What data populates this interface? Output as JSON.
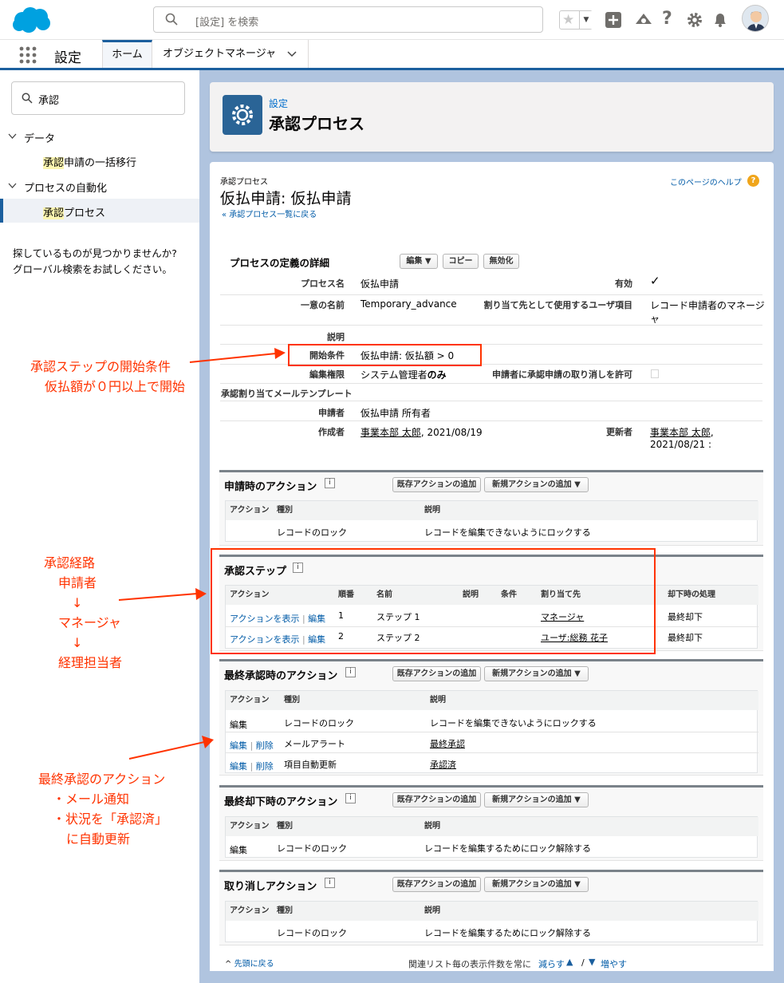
{
  "header": {
    "search_placeholder": "[設定] を検索"
  },
  "nav": {
    "app_name": "設定",
    "tab_home": "ホーム",
    "tab_object_manager": "オブジェクトマネージャ"
  },
  "sidebar": {
    "quickfind_value": "承認",
    "group_data": "データ",
    "item_bulk_prefix": "承認",
    "item_bulk_rest": "申請の一括移行",
    "group_automation": "プロセスの自動化",
    "item_process_prefix": "承認",
    "item_process_rest": "プロセス",
    "not_found_line1": "探しているものが見つかりませんか?",
    "not_found_line2": "グローバル検索をお試しください。"
  },
  "page_header": {
    "breadcrumb": "設定",
    "title": "承認プロセス"
  },
  "detail": {
    "object_label": "承認プロセス",
    "title": "仮払申請: 仮払申請",
    "back_link": "« 承認プロセス一覧に戻る",
    "help_link": "このページのヘルプ",
    "section_title": "プロセスの定義の詳細",
    "btn_edit": "編集 ▼",
    "btn_copy": "コピー",
    "btn_disable": "無効化",
    "fields": {
      "process_name_label": "プロセス名",
      "process_name": "仮払申請",
      "active_label": "有効",
      "active_mark": "✓",
      "unique_name_label": "一意の名前",
      "unique_name": "Temporary_advance",
      "assignee_field_label": "割り当て先として使用するユーザ項目",
      "assignee_field_line1": "レコード申請者のマネージ",
      "assignee_field_line2": "ャ",
      "description_label": "説明",
      "entry_criteria_label": "開始条件",
      "entry_criteria": "仮払申請: 仮払額 > 0",
      "edit_perm_label": "編集権限",
      "edit_perm_a": "システム管理者",
      "edit_perm_b": "のみ",
      "recall_label": "申請者に承認申請の取り消しを許可",
      "email_template_label": "承認割り当てメールテンプレート",
      "submitter_label": "申請者",
      "submitter": "仮払申請 所有者",
      "created_by_label": "作成者",
      "created_by_name": "事業本部 太郎",
      "created_by_date": ", 2021/08/19",
      "modified_by_label": "更新者",
      "modified_by_name": "事業本部 太郎",
      "modified_by_date": "2021/08/21 :"
    }
  },
  "labels": {
    "add_existing": "既存アクションの追加",
    "add_new": "新規アクションの追加 ▼",
    "col_action": "アクション",
    "col_type": "種別",
    "col_desc": "説明",
    "col_order": "順番",
    "col_name": "名前",
    "col_criteria": "条件",
    "col_assigned": "割り当て先",
    "col_reject": "却下時の処理",
    "show_actions": "アクションを表示",
    "edit": "編集",
    "delete": "削除",
    "sep": "|"
  },
  "initial_submission": {
    "title": "申請時のアクション",
    "rows": [
      {
        "type": "レコードのロック",
        "desc": "レコードを編集できないようにロックする"
      }
    ]
  },
  "approval_steps": {
    "title": "承認ステップ",
    "rows": [
      {
        "order": "1",
        "name": "ステップ 1",
        "assigned": "マネージャ",
        "reject": "最終却下"
      },
      {
        "order": "2",
        "name": "ステップ 2",
        "assigned": "ユーザ:総務 花子",
        "reject": "最終却下"
      }
    ]
  },
  "final_approval": {
    "title": "最終承認時のアクション",
    "rows": [
      {
        "type": "レコードのロック",
        "desc": "レコードを編集できないようにロックする"
      },
      {
        "type": "メールアラート",
        "desc": "最終承認"
      },
      {
        "type": "項目自動更新",
        "desc": "承認済"
      }
    ]
  },
  "final_rejection": {
    "title": "最終却下時のアクション",
    "rows": [
      {
        "type": "レコードのロック",
        "desc": "レコードを編集するためにロック解除する"
      }
    ]
  },
  "recall": {
    "title": "取り消しアクション",
    "rows": [
      {
        "type": "レコードのロック",
        "desc": "レコードを編集するためにロック解除する"
      }
    ]
  },
  "footer": {
    "back_to_top": "先頭に戻る",
    "list_size": "関連リスト毎の表示件数を常に",
    "fewer": "減らす",
    "slash": "/",
    "more": "増やす"
  },
  "annotations": {
    "entry1": "承認ステップの開始条件",
    "entry2": "仮払額が０円以上で開始",
    "route1": "承認経路",
    "route2": "申請者",
    "route3": "↓",
    "route4": "マネージャ",
    "route5": "↓",
    "route6": "経理担当者",
    "final1": "最終承認のアクション",
    "final2": "・メール通知",
    "final3": "・状況を「承認済」",
    "final4": "に自動更新"
  },
  "colors": {
    "annotation": "#ff3300",
    "brand": "#1b5f9e",
    "link": "#015ba7"
  }
}
